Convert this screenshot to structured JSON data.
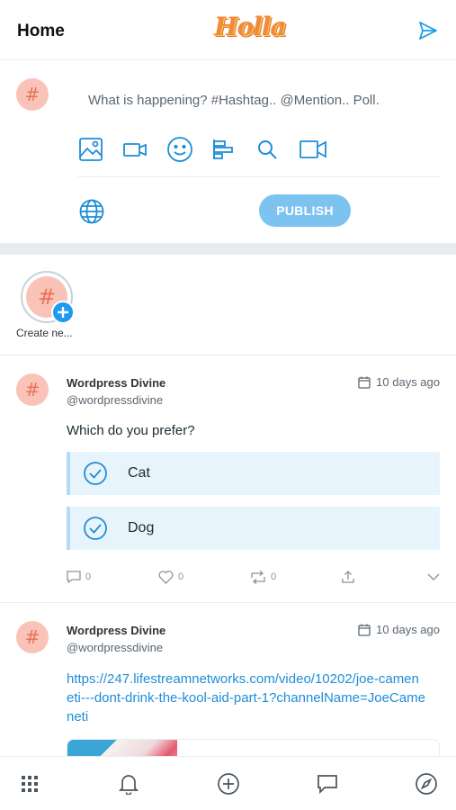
{
  "header": {
    "title": "Home",
    "logo_text": "Holla",
    "send_icon": "send-icon"
  },
  "composer": {
    "avatar_symbol": "#",
    "placeholder": "What is happening? #Hashtag.. @Mention.. Poll.",
    "tools": [
      "image-icon",
      "video-camera-icon",
      "smile-icon",
      "poll-bars-icon",
      "search-icon",
      "video-icon"
    ],
    "privacy_icon": "globe-icon",
    "publish_label": "PUBLISH"
  },
  "stories": {
    "create_label": "Create ne...",
    "avatar_symbol": "#"
  },
  "posts": [
    {
      "author": "Wordpress Divine",
      "handle": "@wordpressdivine",
      "time": "10 days ago",
      "avatar_symbol": "#",
      "text": "Which do you prefer?",
      "poll": [
        "Cat",
        "Dog"
      ],
      "likes": "0",
      "comments": "0",
      "shares": "0"
    },
    {
      "author": "Wordpress Divine",
      "handle": "@wordpressdivine",
      "time": "10 days ago",
      "avatar_symbol": "#",
      "link": "https://247.lifestreamnetworks.com/video/10202/joe-cameneti---dont-drink-the-kool-aid-part-1?channelName=JoeCameneti"
    }
  ],
  "nav": [
    "apps-grid-icon",
    "bell-icon",
    "plus-circle-icon",
    "chat-icon",
    "compass-icon"
  ],
  "colors": {
    "accent": "#1d9bf0",
    "publish_bg": "#7dc3f0",
    "avatar_bg": "#f9c3b7",
    "poll_bg": "#e8f4fc"
  }
}
